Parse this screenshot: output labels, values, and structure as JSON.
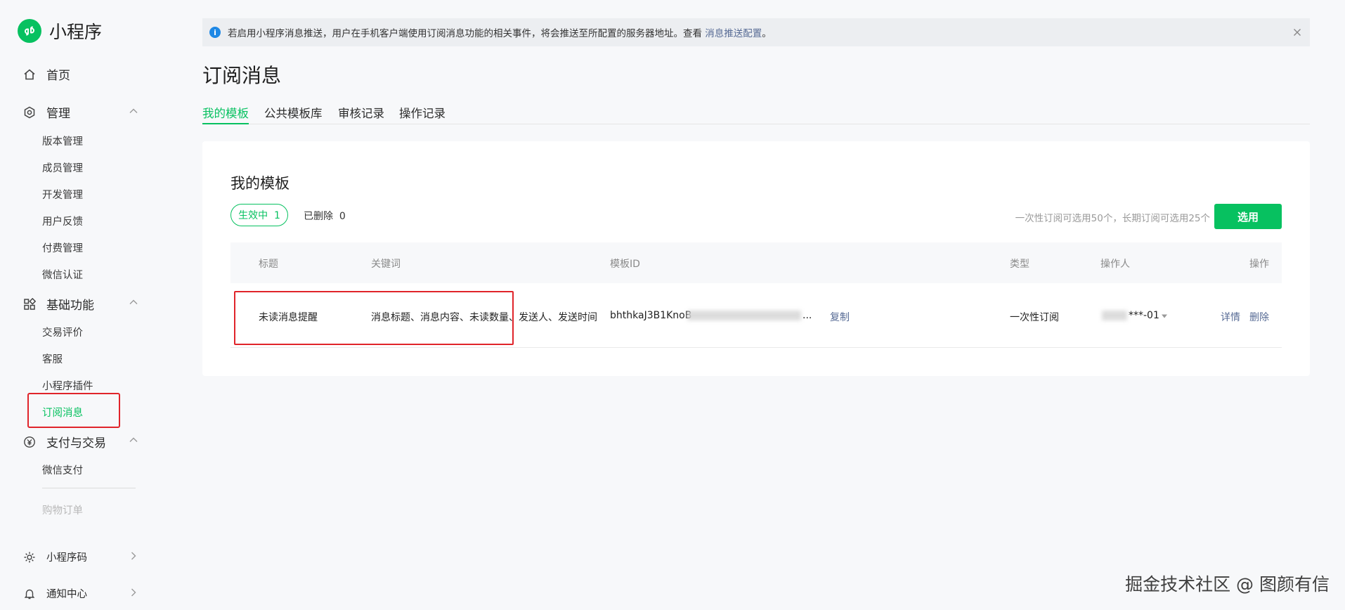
{
  "app": {
    "name": "小程序"
  },
  "sidebar": {
    "home": "首页",
    "sections": [
      {
        "label": "管理",
        "items": [
          "版本管理",
          "成员管理",
          "开发管理",
          "用户反馈",
          "付费管理",
          "微信认证"
        ]
      },
      {
        "label": "基础功能",
        "items": [
          "交易评价",
          "客服",
          "小程序插件",
          "订阅消息"
        ]
      },
      {
        "label": "支付与交易",
        "items": [
          "微信支付"
        ]
      }
    ],
    "disabled_item": "购物订单",
    "bottom": [
      "小程序码",
      "通知中心"
    ],
    "active_item": "订阅消息"
  },
  "notice": {
    "text": "若启用小程序消息推送，用户在手机客户端使用订阅消息功能的相关事件，将会推送至所配置的服务器地址。查看 ",
    "link": "消息推送配置",
    "suffix": "。"
  },
  "page": {
    "title": "订阅消息",
    "tabs": [
      "我的模板",
      "公共模板库",
      "审核记录",
      "操作记录"
    ]
  },
  "card": {
    "title": "我的模板",
    "active_filter": "生效中  1",
    "deleted_filter": "已删除  0",
    "quota": "一次性订阅可选用50个，长期订阅可选用25个",
    "select_button": "选用",
    "columns": [
      "标题",
      "关键词",
      "模板ID",
      "类型",
      "操作人",
      "操作"
    ],
    "rows": [
      {
        "title": "未读消息提醒",
        "keywords": "消息标题、消息内容、未读数量、发送人、发送时间",
        "template_id": "bhthkaJ3B1KnoB",
        "template_id_suffix": "...",
        "copy": "复制",
        "type": "一次性订阅",
        "operator": "***-01",
        "actions": [
          "详情",
          "删除"
        ]
      }
    ]
  },
  "watermark": "掘金技术社区 @ 图颜有信",
  "colors": {
    "accent": "#07c160",
    "link": "#576b95",
    "highlight": "#e0242a",
    "info": "#1e88e5"
  }
}
